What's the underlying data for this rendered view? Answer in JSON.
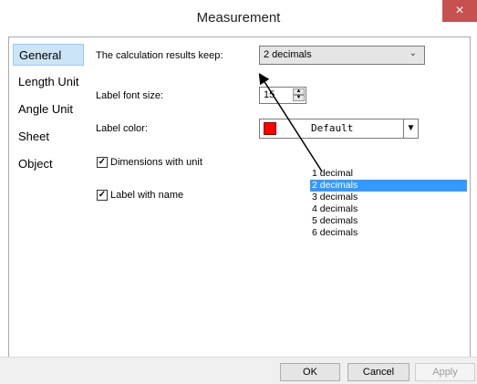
{
  "window": {
    "title": "Measurement",
    "close_glyph": "×"
  },
  "sidebar": {
    "items": [
      {
        "label": "General"
      },
      {
        "label": "Length Unit"
      },
      {
        "label": "Angle Unit"
      },
      {
        "label": "Sheet"
      },
      {
        "label": "Object"
      }
    ]
  },
  "settings": {
    "calc_label": "The calculation results keep:",
    "calc_value": "2 decimals",
    "font_size_label": "Label font size:",
    "font_size_value": "15",
    "color_label": "Label color:",
    "color_value": "Default",
    "dimensions_label": "Dimensions with unit",
    "labelname_label": "Label with name"
  },
  "dropdown": {
    "options": [
      "1 decimal",
      "2 decimals",
      "3 decimals",
      "4 decimals",
      "5 decimals",
      "6 decimals"
    ],
    "selected": "2 decimals"
  },
  "footer": {
    "ok_label": "OK",
    "cancel_label": "Cancel",
    "apply_label": "Apply"
  },
  "colors": {
    "selection": "#3399ff",
    "sidebar_active": "#cce4f7",
    "close_button": "#c75050",
    "swatch": "#ff0000"
  }
}
